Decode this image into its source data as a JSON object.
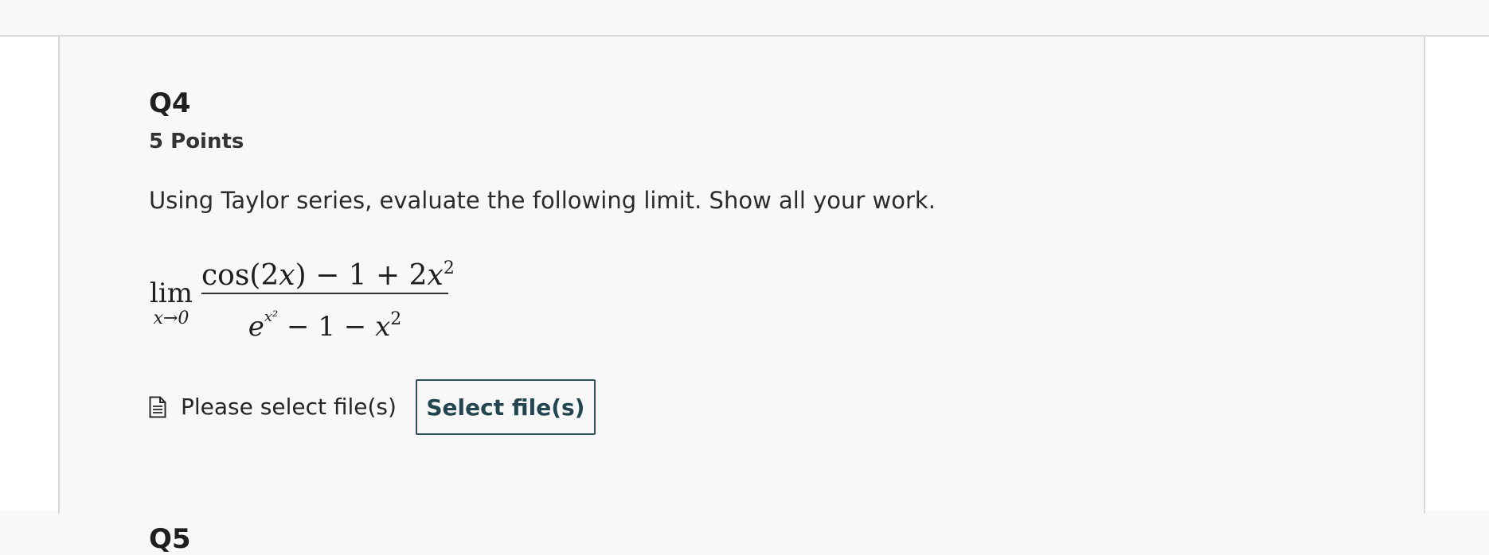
{
  "question": {
    "title": "Q4",
    "points": "5 Points",
    "prompt": "Using Taylor series, evaluate the following limit. Show all your work.",
    "limit": {
      "operator": "lim",
      "subscript": "x→0",
      "numerator": "cos(2x) − 1 + 2x²",
      "denominator": "e^(x²) − 1 − x²"
    }
  },
  "upload": {
    "status": "Please select file(s)",
    "button_label": "Select file(s)",
    "icon": "file-text-icon"
  },
  "next_question": {
    "title": "Q5"
  }
}
